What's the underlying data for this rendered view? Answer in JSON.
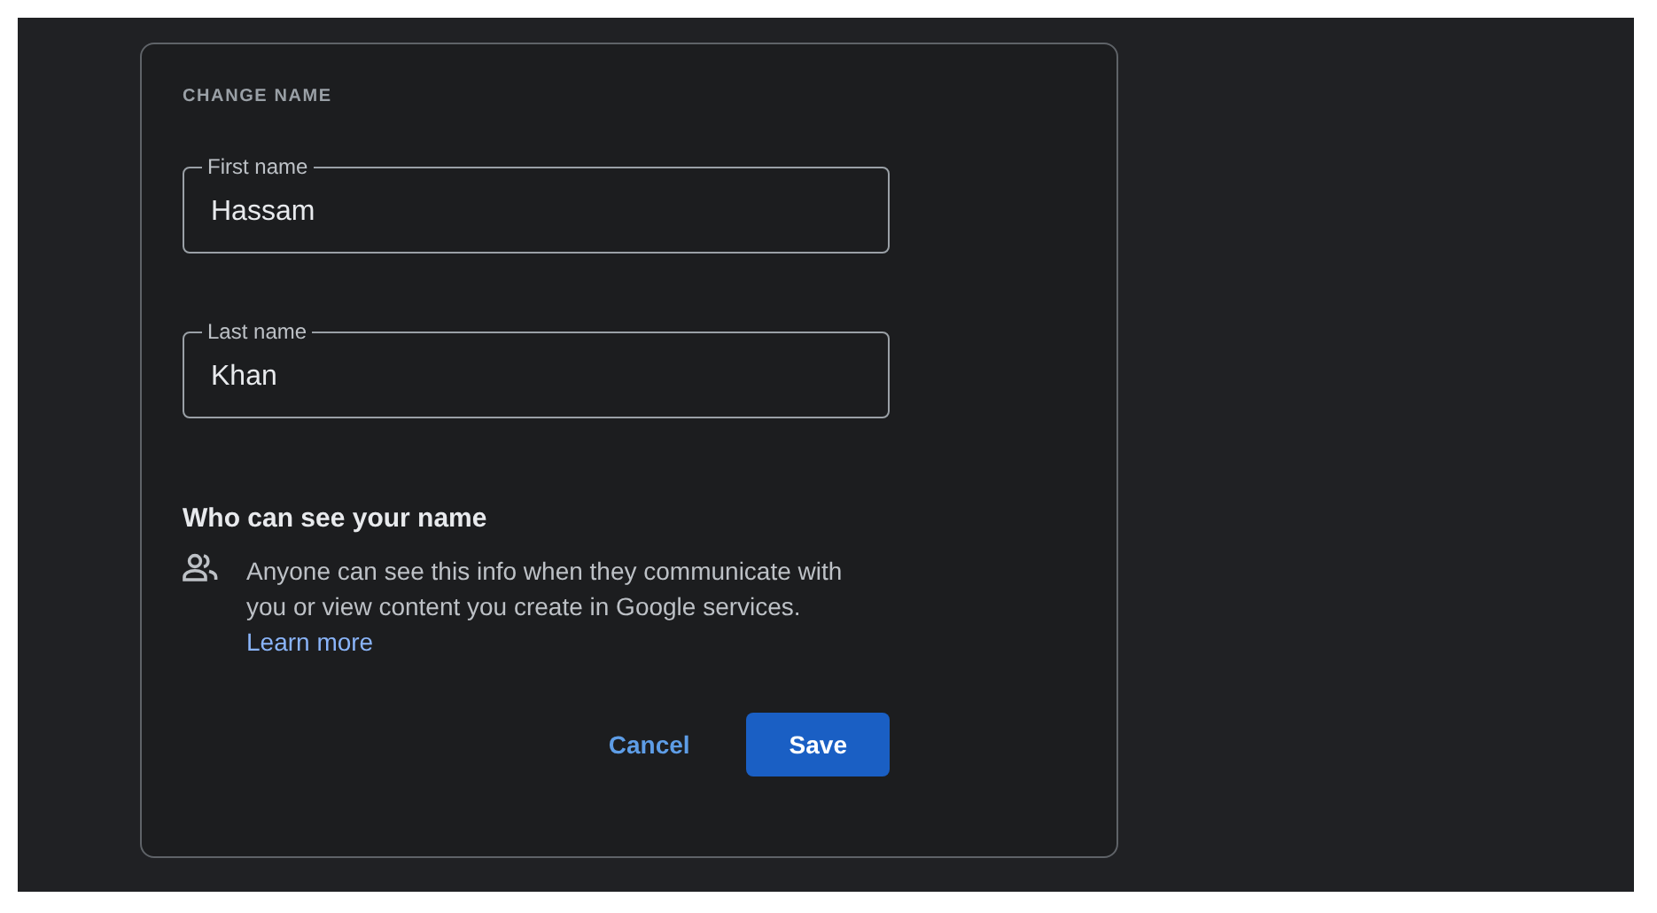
{
  "card": {
    "title": "CHANGE NAME",
    "fields": [
      {
        "label": "First name",
        "value": "Hassam"
      },
      {
        "label": "Last name",
        "value": "Khan"
      }
    ],
    "visibility": {
      "heading": "Who can see your name",
      "text": "Anyone can see this info when they communicate with you or view content you create in Google services.",
      "link": "Learn more"
    },
    "buttons": [
      {
        "label": "Cancel",
        "kind": "text"
      },
      {
        "label": "Save",
        "kind": "filled"
      }
    ]
  }
}
